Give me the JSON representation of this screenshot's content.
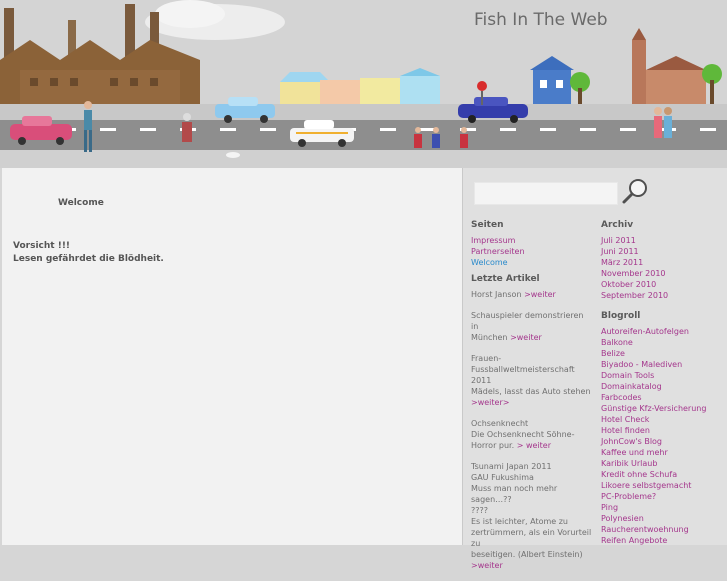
{
  "site": {
    "title": "Fish In The Web"
  },
  "main": {
    "welcome": "Welcome",
    "warning_line1": "Vorsicht !!!",
    "warning_line2": "Lesen gefährdet die Blödheit."
  },
  "search": {
    "placeholder": "",
    "value": ""
  },
  "sidebar": {
    "seiten_title": "Seiten",
    "seiten": [
      {
        "label": "Impressum"
      },
      {
        "label": "Partnerseiten"
      },
      {
        "label": "Welcome"
      }
    ],
    "artikel_title": "Letzte Artikel",
    "artikel": [
      {
        "lines": [
          "Horst Janson"
        ],
        "more": ">weiter"
      },
      {
        "lines": [
          "Schauspieler demonstrieren in",
          "München"
        ],
        "more": ">weiter"
      },
      {
        "lines": [
          "Frauen-",
          "Fussballweltmeisterschaft 2011",
          "Mädels, lasst das Auto stehen"
        ],
        "more": ">weiter>"
      },
      {
        "lines": [
          "Ochsenknecht",
          "Die Ochsenknecht Söhne-",
          "Horror pur."
        ],
        "more": "> weiter"
      },
      {
        "lines": [
          "Tsunami Japan 2011",
          "GAU Fukushima",
          "Muss man noch mehr sagen…??",
          "????",
          "Es ist leichter, Atome zu",
          "zertrümmern, als ein Vorurteil zu",
          "beseitigen. (Albert Einstein)"
        ],
        "more": ">weiter"
      }
    ],
    "archiv_title": "Archiv",
    "archiv": [
      {
        "label": "Juli 2011"
      },
      {
        "label": "Juni 2011"
      },
      {
        "label": "März 2011"
      },
      {
        "label": "November 2010"
      },
      {
        "label": "Oktober 2010"
      },
      {
        "label": "September 2010"
      }
    ],
    "blogroll_title": "Blogroll",
    "blogroll": [
      {
        "label": "Autoreifen-Autofelgen"
      },
      {
        "label": "Balkone"
      },
      {
        "label": "Belize"
      },
      {
        "label": "Biyadoo - Malediven"
      },
      {
        "label": "Domain Tools"
      },
      {
        "label": "Domainkatalog"
      },
      {
        "label": "Farbcodes"
      },
      {
        "label": "Günstige Kfz-Versicherung"
      },
      {
        "label": "Hotel Check"
      },
      {
        "label": "Hotel finden"
      },
      {
        "label": "JohnCow's Blog"
      },
      {
        "label": "Kaffee und mehr"
      },
      {
        "label": "Karibik Urlaub"
      },
      {
        "label": "Kredit ohne Schufa"
      },
      {
        "label": "Likoere selbstgemacht"
      },
      {
        "label": "PC-Probleme?"
      },
      {
        "label": "Ping"
      },
      {
        "label": "Polynesien"
      },
      {
        "label": "Raucherentwoehnung"
      },
      {
        "label": "Reifen Angebote"
      }
    ]
  },
  "colors": {
    "link": "#a4368c",
    "active_link": "#2a8acb"
  }
}
